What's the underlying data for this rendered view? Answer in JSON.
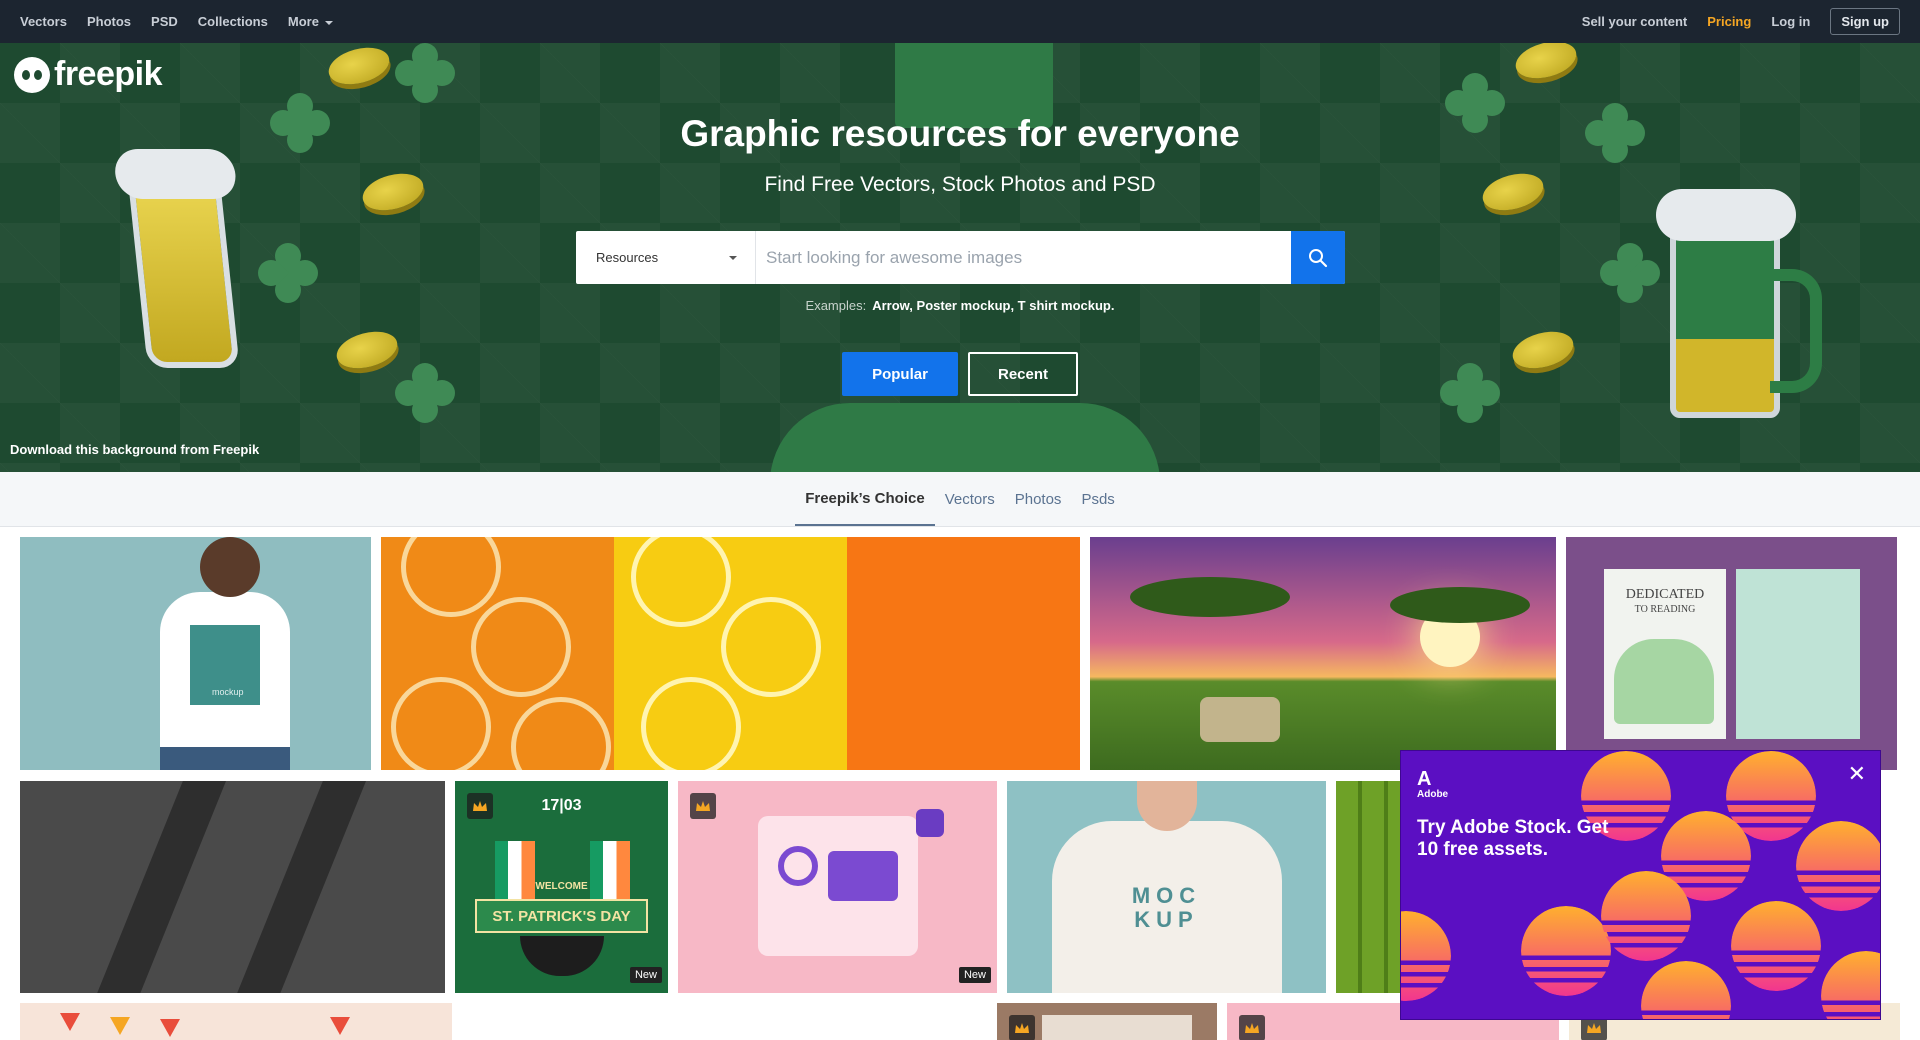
{
  "nav": {
    "left": [
      "Vectors",
      "Photos",
      "PSD",
      "Collections"
    ],
    "more": "More",
    "sell": "Sell your content",
    "pricing": "Pricing",
    "login": "Log in",
    "signup": "Sign up"
  },
  "brand": {
    "name": "freepik"
  },
  "hero": {
    "title": "Graphic resources for everyone",
    "subtitle": "Find Free Vectors, Stock Photos and PSD",
    "search": {
      "select_value": "Resources",
      "placeholder": "Start looking for awesome images"
    },
    "examples_label": "Examples:",
    "examples": "Arrow, Poster mockup, T shirt mockup.",
    "popular": "Popular",
    "recent": "Recent",
    "credit": "Download this background from Freepik"
  },
  "tabs": [
    "Freepik’s Choice",
    "Vectors",
    "Photos",
    "Psds"
  ],
  "tiles": {
    "book_title": "DEDICATED",
    "book_sub": "TO READING",
    "mockup_text_1": "MOC",
    "mockup_text_2": "KUP",
    "patrick_date": "17|03",
    "patrick_title": "ST. PATRICK'S DAY",
    "patrick_welcome": "WELCOME",
    "shirt_label": "mockup",
    "new_badge": "New"
  },
  "ad": {
    "brand": "Adobe",
    "headline": "Try Adobe Stock. Get 10 free assets."
  },
  "colors": {
    "nav_bg": "#1c2530",
    "hero_bg": "#1e4a30",
    "accent_blue": "#1273eb",
    "pricing": "#f5a623",
    "ad_bg": "#5b0fc2"
  }
}
